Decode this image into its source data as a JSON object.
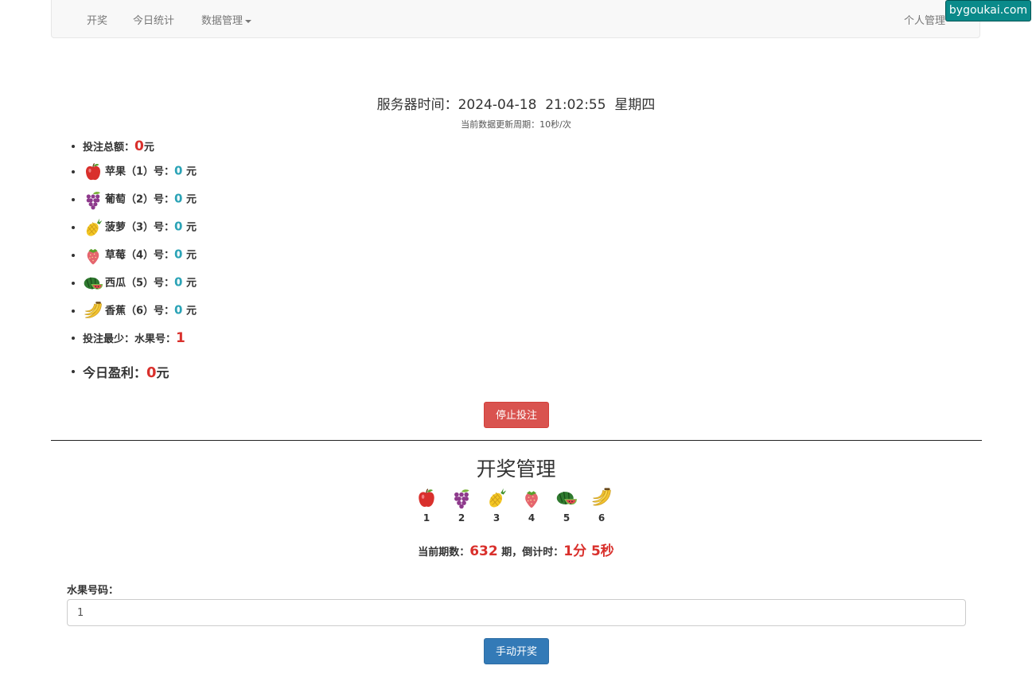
{
  "nav": {
    "items": [
      {
        "label": "开奖"
      },
      {
        "label": "今日统计"
      },
      {
        "label": "数据管理"
      }
    ],
    "right": "个人管理"
  },
  "watermark": "bygoukai.com",
  "server_time": {
    "label": "服务器时间：",
    "value": "2024-04-18  21:02:55  星期四"
  },
  "refresh_note": "当前数据更新周期：10秒/次",
  "stats": {
    "total": {
      "label": "投注总额：",
      "value": "0",
      "unit": "元"
    },
    "fruits": [
      {
        "name": "苹果（1）号：",
        "value": "0",
        "unit": " 元",
        "icon": "apple-icon"
      },
      {
        "name": "葡萄（2）号：",
        "value": "0",
        "unit": " 元",
        "icon": "grape-icon"
      },
      {
        "name": "菠萝（3）号：",
        "value": "0",
        "unit": " 元",
        "icon": "pineapple-icon"
      },
      {
        "name": "草莓（4）号：",
        "value": "0",
        "unit": " 元",
        "icon": "strawberry-icon"
      },
      {
        "name": "西瓜（5）号：",
        "value": "0",
        "unit": " 元",
        "icon": "watermelon-icon"
      },
      {
        "name": "香蕉（6）号：",
        "value": "0",
        "unit": " 元",
        "icon": "banana-icon"
      }
    ],
    "min_bet": {
      "label": "投注最少：水果号：",
      "value": "1"
    },
    "profit": {
      "label": "今日盈利：",
      "value": "0",
      "unit": "元"
    }
  },
  "stop_button": "停止投注",
  "draw": {
    "title": "开奖管理",
    "fruits": [
      {
        "number": "1",
        "icon": "apple-icon"
      },
      {
        "number": "2",
        "icon": "grape-icon"
      },
      {
        "number": "3",
        "icon": "pineapple-icon"
      },
      {
        "number": "4",
        "icon": "strawberry-icon"
      },
      {
        "number": "5",
        "icon": "watermelon-icon"
      },
      {
        "number": "6",
        "icon": "banana-icon"
      }
    ],
    "period_label": "当前期数：",
    "period_value": "632",
    "period_suffix": " 期，倒计时：",
    "countdown": "1分 5秒"
  },
  "fruit_input": {
    "label": "水果号码：",
    "value": "1"
  },
  "manual_button": "手动开奖",
  "colors": {
    "danger": "#d9534f",
    "primary": "#337ab7",
    "highlight_red": "#d9302c",
    "highlight_cyan": "#2ba3b6"
  }
}
